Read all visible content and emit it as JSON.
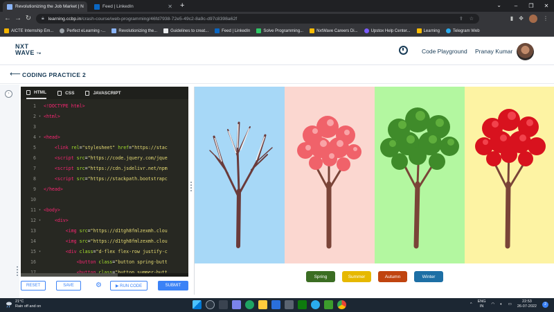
{
  "browser": {
    "tabs": [
      {
        "title": "Revolutionizing the Job Market | N",
        "active": true
      },
      {
        "title": "Feed | LinkedIn",
        "active": false
      }
    ],
    "url_host": "learning.ccbp.in",
    "url_path": "/crash-course/web-programming/46fd7938-72e5-49c2-8a9c-d97c8398a62f",
    "bookmarks": [
      "AICTE Internship Em...",
      "Perfect eLearning -...",
      "Revolutionizing the...",
      "Guidelines to creat...",
      "Feed | LinkedIn",
      "Solve Programming...",
      "NxtWave Careers Di...",
      "Upstox Help Center...",
      "Learning",
      "Telegram Web"
    ]
  },
  "header": {
    "logo_line1": "NXT",
    "logo_line2": "WAVE",
    "logo_tm": "TM",
    "playground": "Code Playground",
    "user_name": "Pranay Kumar"
  },
  "page": {
    "title": "CODING PRACTICE 2"
  },
  "editor": {
    "tabs": [
      "HTML",
      "CSS",
      "JAVASCRIPT"
    ],
    "lines": [
      {
        "n": "1",
        "fold": "",
        "html": "<span class=\"tg\">&lt;!DOCTYPE html&gt;</span>"
      },
      {
        "n": "2",
        "fold": "▾",
        "html": "<span class=\"tg\">&lt;html&gt;</span>"
      },
      {
        "n": "3",
        "fold": "",
        "html": ""
      },
      {
        "n": "4",
        "fold": "▾",
        "html": "<span class=\"tg\">&lt;head&gt;</span>"
      },
      {
        "n": "5",
        "fold": "",
        "html": "    <span class=\"tg\">&lt;link</span> <span class=\"at\">rel</span>=<span class=\"st\">\"stylesheet\"</span> <span class=\"at\">href</span>=<span class=\"st\">\"https://stac</span>"
      },
      {
        "n": "6",
        "fold": "",
        "html": "    <span class=\"tg\">&lt;script</span> <span class=\"at\">src</span>=<span class=\"st\">\"https://code.jquery.com/jque</span>"
      },
      {
        "n": "7",
        "fold": "",
        "html": "    <span class=\"tg\">&lt;script</span> <span class=\"at\">src</span>=<span class=\"st\">\"https://cdn.jsdelivr.net/npm</span>"
      },
      {
        "n": "8",
        "fold": "",
        "html": "    <span class=\"tg\">&lt;script</span> <span class=\"at\">src</span>=<span class=\"st\">\"https://stackpath.bootstrapc</span>"
      },
      {
        "n": "9",
        "fold": "",
        "html": "<span class=\"tg\">&lt;/head&gt;</span>"
      },
      {
        "n": "10",
        "fold": "",
        "html": ""
      },
      {
        "n": "11",
        "fold": "▾",
        "html": "<span class=\"tg\">&lt;body&gt;</span>"
      },
      {
        "n": "12",
        "fold": "▾",
        "html": "    <span class=\"tg\">&lt;div&gt;</span>"
      },
      {
        "n": "13",
        "fold": "",
        "html": "        <span class=\"tg\">&lt;img</span> <span class=\"at\">src</span>=<span class=\"st\">\"https://d1tgh8fmlzexmh.clou</span>"
      },
      {
        "n": "14",
        "fold": "",
        "html": "        <span class=\"tg\">&lt;img</span> <span class=\"at\">src</span>=<span class=\"st\">\"https://d1tgh8fmlzexmh.clou</span>"
      },
      {
        "n": "15",
        "fold": "▾",
        "html": "        <span class=\"tg\">&lt;div</span> <span class=\"at\">class</span>=<span class=\"st\">\"d-flex flex-row justify-c</span>"
      },
      {
        "n": "16",
        "fold": "",
        "html": "            <span class=\"tg\">&lt;button</span> <span class=\"at\">class</span>=<span class=\"st\">\"button spring-butt</span>"
      },
      {
        "n": "17",
        "fold": "",
        "html": "            <span class=\"tg\">&lt;button</span> <span class=\"at\">class</span>=<span class=\"st\">\"button summer-butt</span>"
      }
    ]
  },
  "actions": {
    "reset": "RESET",
    "save": "SAVE",
    "run": "▶ RUN CODE",
    "submit": "SUBMIT"
  },
  "preview": {
    "seasons": [
      {
        "key": "winter-bare",
        "bg": "#a7d8f7"
      },
      {
        "key": "spring",
        "bg": "#fbd7d0"
      },
      {
        "key": "summer",
        "bg": "#b3f7a0"
      },
      {
        "key": "autumn",
        "bg": "#fdf3a3"
      }
    ],
    "buttons": [
      {
        "label": "Spring",
        "color": "#3b6d23"
      },
      {
        "label": "Summer",
        "color": "#e6b800"
      },
      {
        "label": "Autumn",
        "color": "#c0440f"
      },
      {
        "label": "Winter",
        "color": "#1d6fa5"
      }
    ]
  },
  "taskbar": {
    "temp": "21°C",
    "weather": "Rain off and on",
    "lang1": "ENG",
    "lang2": "IN",
    "time": "22:53",
    "date": "26-07-2022",
    "notif": "2"
  }
}
